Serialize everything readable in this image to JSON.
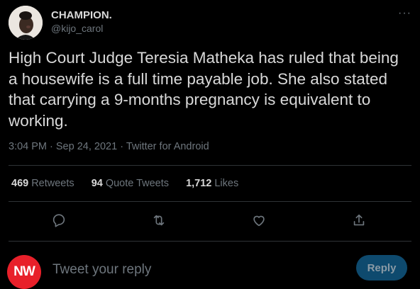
{
  "author": {
    "display_name": "CHAMPION.",
    "handle": "@kijo_carol"
  },
  "more_glyph": "···",
  "tweet": {
    "text": "High Court Judge Teresia Matheka has ruled that being a housewife is a full time payable job. She also stated that carrying a 9-months pregnancy is equivalent to working.",
    "time": "3:04 PM",
    "date": "Sep 24, 2021",
    "source": "Twitter for Android"
  },
  "stats": {
    "retweets_count": "469",
    "retweets_label": "Retweets",
    "quote_count": "94",
    "quote_label": "Quote Tweets",
    "likes_count": "1,712",
    "likes_label": "Likes"
  },
  "actions": {
    "icons": [
      "comment-icon",
      "retweet-icon",
      "like-icon",
      "share-icon"
    ]
  },
  "reply": {
    "avatar_text": "NW",
    "placeholder": "Tweet your reply",
    "button_label": "Reply"
  },
  "colors": {
    "background": "#000000",
    "text": "#d9d9d9",
    "muted": "#6e767d",
    "divider": "#2f3336",
    "reply_button": "#0e4a6e",
    "avatar_badge": "#e8202a"
  }
}
